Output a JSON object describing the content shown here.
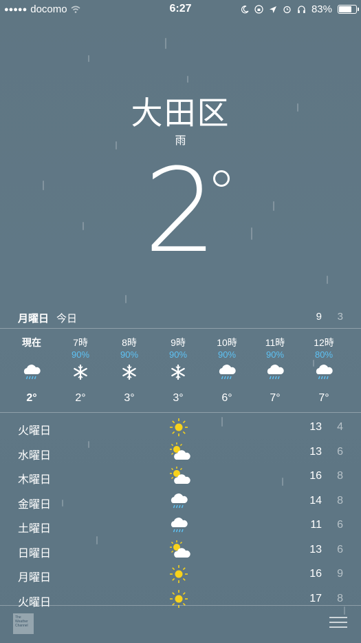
{
  "status_bar": {
    "carrier": "docomo",
    "time": "6:27",
    "battery_percent": "83%"
  },
  "location": {
    "city": "大田区",
    "condition": "雨",
    "temperature": "2"
  },
  "today": {
    "day": "月曜日",
    "label": "今日",
    "high": "9",
    "low": "3"
  },
  "hourly": [
    {
      "time": "現在",
      "precip": "",
      "icon": "rain-cloud-icon",
      "temp": "2°"
    },
    {
      "time": "7時",
      "precip": "90%",
      "icon": "snowflake-icon",
      "temp": "2°"
    },
    {
      "time": "8時",
      "precip": "90%",
      "icon": "snowflake-icon",
      "temp": "3°"
    },
    {
      "time": "9時",
      "precip": "90%",
      "icon": "snowflake-icon",
      "temp": "3°"
    },
    {
      "time": "10時",
      "precip": "90%",
      "icon": "rain-cloud-icon",
      "temp": "6°"
    },
    {
      "time": "11時",
      "precip": "90%",
      "icon": "rain-cloud-icon",
      "temp": "7°"
    },
    {
      "time": "12時",
      "precip": "80%",
      "icon": "rain-cloud-icon",
      "temp": "7°"
    }
  ],
  "daily": [
    {
      "day": "火曜日",
      "icon": "sun-icon",
      "high": "13",
      "low": "4"
    },
    {
      "day": "水曜日",
      "icon": "partly-cloudy-icon",
      "high": "13",
      "low": "6"
    },
    {
      "day": "木曜日",
      "icon": "partly-cloudy-icon",
      "high": "16",
      "low": "8"
    },
    {
      "day": "金曜日",
      "icon": "rain-cloud-icon",
      "high": "14",
      "low": "8"
    },
    {
      "day": "土曜日",
      "icon": "rain-cloud-icon",
      "high": "11",
      "low": "6"
    },
    {
      "day": "日曜日",
      "icon": "partly-cloudy-icon",
      "high": "13",
      "low": "6"
    },
    {
      "day": "月曜日",
      "icon": "sun-icon",
      "high": "16",
      "low": "9"
    },
    {
      "day": "火曜日",
      "icon": "sun-icon",
      "high": "17",
      "low": "8"
    }
  ],
  "footer": {
    "logo_text": "The Weather Channel"
  },
  "colors": {
    "background": "#5f7683",
    "precip": "#5ec2f4",
    "sun": "#f7d21c"
  }
}
